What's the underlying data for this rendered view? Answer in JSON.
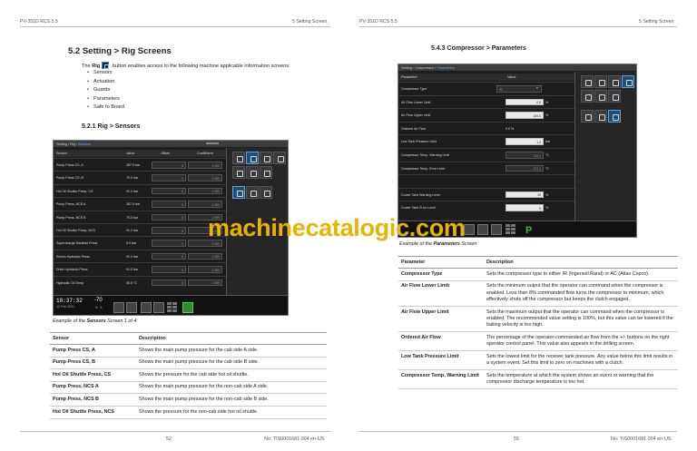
{
  "left_page": {
    "header_left": "PV-351D RCS 5.5",
    "header_right": "5 Setting Screen",
    "section_title": "5.2  Setting > Rig Screens",
    "intro_pre": "The ",
    "intro_bold": "Rig",
    "intro_post": " button enables access to the following machine applicable information screens:",
    "bullets": [
      "Sensors",
      "Actuation",
      "Guards",
      "Parameters",
      "Safe to Board"
    ],
    "subsection_title": "5.2.1 Rig > Sensors",
    "screen": {
      "breadcrumb": "Setting › Rig › ",
      "breadcrumb_current": "Sensors",
      "columns": [
        "Sensor",
        "Value",
        "Offset",
        "Coefficient"
      ],
      "rows": [
        {
          "sensor": "Pump Press CS, A",
          "value": "287.0 bar",
          "offset": "0",
          "coef": "1.000"
        },
        {
          "sensor": "Pump Press CS, B",
          "value": "75.0 bar",
          "offset": "0",
          "coef": "1.000"
        },
        {
          "sensor": "Hot Oil Shuttle Press, CS",
          "value": "91.0 bar",
          "offset": "0",
          "coef": "1.000"
        },
        {
          "sensor": "Pump Press, NCS A",
          "value": "287.0 bar",
          "offset": "0",
          "coef": "1.000"
        },
        {
          "sensor": "Pump Press, NCS B",
          "value": "75.0 bar",
          "offset": "0",
          "coef": "1.000"
        },
        {
          "sensor": "Hot Oil Shuttle Press, NCS",
          "value": "91.0 bar",
          "offset": "0",
          "coef": "1.000"
        },
        {
          "sensor": "Supercharge Manifold Press",
          "value": "9.0 bar",
          "offset": "0",
          "coef": "1.000"
        },
        {
          "sensor": "Return Hydraulic Press",
          "value": "91.0 bar",
          "offset": "0",
          "coef": "1.000"
        },
        {
          "sensor": "Drive Hydraulic Press",
          "value": "91.0 bar",
          "offset": "0",
          "coef": "1.000"
        },
        {
          "sensor": "Hydraulic Oil Temp",
          "value": "55.5 °C",
          "offset": "0",
          "coef": "1.000"
        }
      ],
      "clock": "18:37:32",
      "date": "12 Feb 2021",
      "reading_big": "-70",
      "reading_small": "N · A"
    },
    "caption_pre": "Example of the ",
    "caption_bold": "Sensors",
    "caption_post": " Screen 1 of 4",
    "table": {
      "headers": [
        "Sensor",
        "Description"
      ],
      "rows": [
        [
          "Pump Press CS, A",
          "Shows the main pump pressure for the cab side A side."
        ],
        [
          "Pump Press CS, B",
          "Shows the main pump pressure for the cab side B side."
        ],
        [
          "Hot Oil Shuttle Press, CS",
          "Shows the pressure for the cab side hot oil shuttle."
        ],
        [
          "Pump Press, NCS A",
          "Shows the main pump pressure for the non-cab side A side."
        ],
        [
          "Pump Press, NCS B",
          "Shows the main pump pressure for the non-cab side B side."
        ],
        [
          "Hot Oil Shuttle Press, NCS",
          "Shows the pressure for the non-cab side hot oil shuttle."
        ]
      ]
    },
    "page_number": "52",
    "doc_number": "No: TIS0001681.004 en-US"
  },
  "right_page": {
    "header_left": "PV-351D RCS 5.5",
    "header_right": "5 Setting Screen",
    "section_title": "5.4.3 Compressor > Parameters",
    "screen": {
      "breadcrumb": "Setting › Compressor › ",
      "breadcrumb_current": "Parameters",
      "columns": [
        "Parameter",
        "Value"
      ],
      "rows": [
        {
          "param": "Compressor Type",
          "value": "IR",
          "unit": "",
          "kind": "select"
        },
        {
          "param": "Air Flow Lower Limit",
          "value": "0.0",
          "unit": "%",
          "kind": "input"
        },
        {
          "param": "Air Flow Upper Limit",
          "value": "100.0",
          "unit": "%",
          "kind": "input"
        },
        {
          "param": "Ordered Air Flow",
          "value": "0.0 %",
          "unit": "",
          "kind": "text"
        },
        {
          "param": "Low Tank Pressure Limit",
          "value": "1.4",
          "unit": "bar",
          "kind": "input"
        },
        {
          "param": "Compressor Temp, Warning Limit",
          "value": "100.0",
          "unit": "°C",
          "kind": "dark"
        },
        {
          "param": "Compressor Temp, Error Limit",
          "value": "121.1",
          "unit": "°C",
          "kind": "dark"
        },
        {
          "param": "",
          "value": "",
          "unit": "",
          "kind": "empty"
        },
        {
          "param": "Cooler Tank Warning Level",
          "value": "20",
          "unit": "%",
          "kind": "input"
        },
        {
          "param": "Cooler Tank Error Level",
          "value": "5",
          "unit": "%",
          "kind": "input"
        }
      ],
      "p_label": "P"
    },
    "caption_pre": "Example of the ",
    "caption_bold": "Parameters",
    "caption_post": " Screen",
    "table": {
      "headers": [
        "Parameter",
        "Description"
      ],
      "rows": [
        [
          "Compressor Type",
          "Sets the compressor type to either IR (Ingersoll Rand) or AC (Atlas Copco)."
        ],
        [
          "Air Flow Lower Limit",
          "Sets the minimum output that the operator can command when the compressor is enabled. Less than 8% commanded flow turns the compressor to minimum, which effectively shuts off the compressor but keeps the clutch engaged."
        ],
        [
          "Air Flow Upper Limit",
          "Sets the maximum output that the operator can command when the compressor is enabled. The recommended value setting is 100%, but this value can be lowered if the bailing velocity is too high."
        ],
        [
          "Ordered Air Flow",
          "The percentage of the operator-commanded air flow from the +/- buttons on the right operator control panel. This value also appears in the drilling screen."
        ],
        [
          "Low Tank Pressure Limit",
          "Sets the lowest limit for the receiver tank pressure. Any value below this limit results in a system event. Set this limit to zero on machines with a clutch."
        ],
        [
          "Compressor Temp, Warning Limit",
          "Sets the temperature at which the system shows an event or warning that the compressor discharge temperature is too hot."
        ]
      ]
    },
    "page_number": "55",
    "doc_number": "No: TIS0001681.004 en-US"
  },
  "watermark": "machinecatalogic.com"
}
